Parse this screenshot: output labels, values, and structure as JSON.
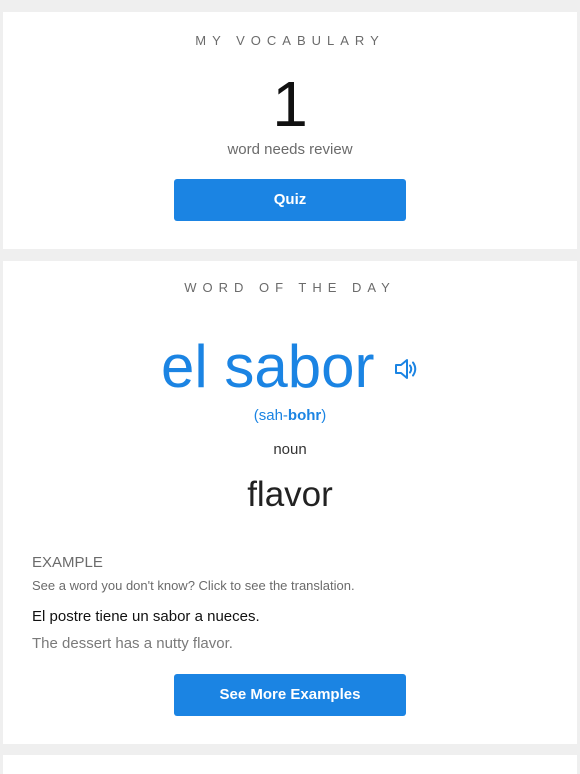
{
  "vocabulary": {
    "title": "MY VOCABULARY",
    "count": "1",
    "review_text": "word needs review",
    "quiz_label": "Quiz"
  },
  "word_of_the_day": {
    "title": "WORD OF THE DAY",
    "word": "el sabor",
    "pronunciation_prefix": "(sah-",
    "pronunciation_stress": "bohr",
    "pronunciation_suffix": ")",
    "part_of_speech": "noun",
    "translation": "flavor",
    "example_label": "EXAMPLE",
    "example_hint": "See a word you don't know? Click to see the translation.",
    "example_spanish": "El postre tiene un sabor a nueces.",
    "example_english": "The dessert has a nutty flavor.",
    "more_examples_label": "See More Examples",
    "speaker_icon": "speaker-icon"
  },
  "colors": {
    "accent": "#1b84e3",
    "background": "#efefef",
    "card": "#ffffff"
  }
}
